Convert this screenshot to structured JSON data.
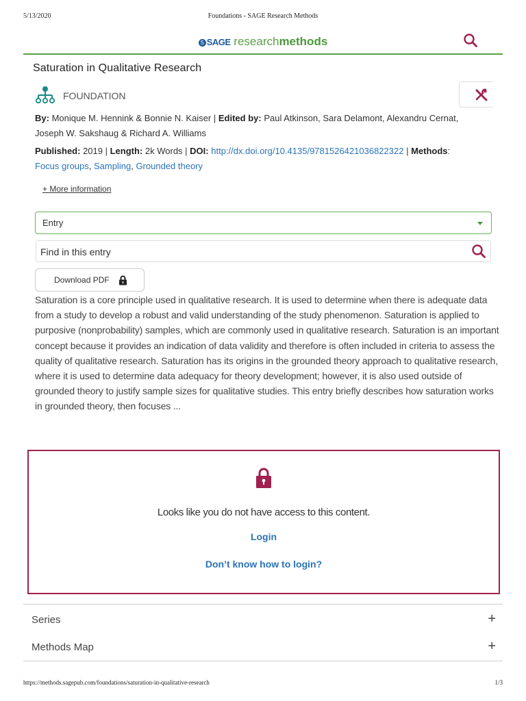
{
  "print_header": {
    "date": "5/13/2020",
    "title": "Foundations - SAGE Research Methods"
  },
  "site": {
    "logo_sage": "SAGE",
    "logo_research": "research",
    "logo_methods": "methods",
    "search_icon": "search-icon",
    "accent_green": "#5a9e47",
    "accent_maroon": "#a0204f",
    "link_blue": "#2a73b8"
  },
  "entry": {
    "title": "Saturation in Qualitative Research",
    "type_label": "FOUNDATION",
    "by_label": "By:",
    "authors": "Monique M. Hennink & Bonnie N. Kaiser",
    "edited_label": "Edited by:",
    "editors_line1": "Paul Atkinson, Sara Delamont, Alexandru Cernat,",
    "editors_line2": "Joseph W. Sakshaug & Richard A. Williams",
    "published_label": "Published:",
    "published": "2019",
    "length_label": "Length:",
    "length": "2k Words",
    "doi_label": "DOI:",
    "doi": "http://dx.doi.org/10.4135/9781526421036822322",
    "methods_label": "Methods",
    "methods": [
      "Focus groups",
      "Sampling",
      "Grounded theory"
    ],
    "more_info": "+ More information"
  },
  "controls": {
    "section_select": "Entry",
    "find_placeholder": "Find in this entry",
    "download_pdf": "Download PDF"
  },
  "abstract": "Saturation is a core principle used in qualitative research. It is used to determine when there is adequate data from a study to develop a robust and valid understanding of the study phenomenon. Saturation is applied to purposive (nonprobability) samples, which are commonly used in qualitative research. Saturation is an important concept because it provides an indication of data validity and therefore is often included in criteria to assess the quality of qualitative research. Saturation has its origins in the grounded theory approach to qualitative research, where it is used to determine data adequacy for theory development; however, it is also used outside of grounded theory to justify sample sizes for qualitative studies. This entry briefly describes how saturation works in grounded theory, then focuses ...",
  "access": {
    "message": "Looks like you do not have access to this content.",
    "login": "Login",
    "help": "Don’t know how to login?"
  },
  "accordion": [
    {
      "label": "Series",
      "icon": "+"
    },
    {
      "label": "Methods Map",
      "icon": "+"
    }
  ],
  "print_footer": {
    "url": "https://methods.sagepub.com/foundations/saturation-in-qualitative-research",
    "page": "1/3"
  }
}
